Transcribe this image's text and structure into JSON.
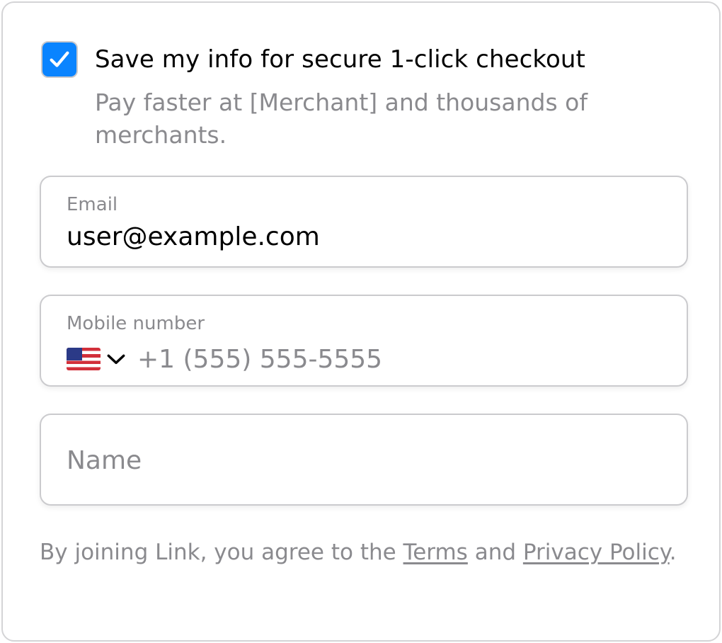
{
  "save_info": {
    "checked": true,
    "title": "Save my info for secure 1-click checkout",
    "subtitle": "Pay faster at [Merchant] and thousands of merchants."
  },
  "email": {
    "label": "Email",
    "value": "user@example.com"
  },
  "mobile": {
    "label": "Mobile number",
    "country_flag": "us-flag-icon",
    "placeholder": "+1 (555) 555-5555"
  },
  "name": {
    "placeholder": "Name"
  },
  "legal": {
    "prefix": "By joining Link, you agree to the ",
    "terms_link": "Terms",
    "middle": " and ",
    "privacy_link": "Privacy Policy",
    "suffix": "."
  },
  "colors": {
    "accent": "#0a84ff",
    "text_primary": "#000000",
    "text_secondary": "#8a8a8e",
    "border": "#cbcbce"
  }
}
